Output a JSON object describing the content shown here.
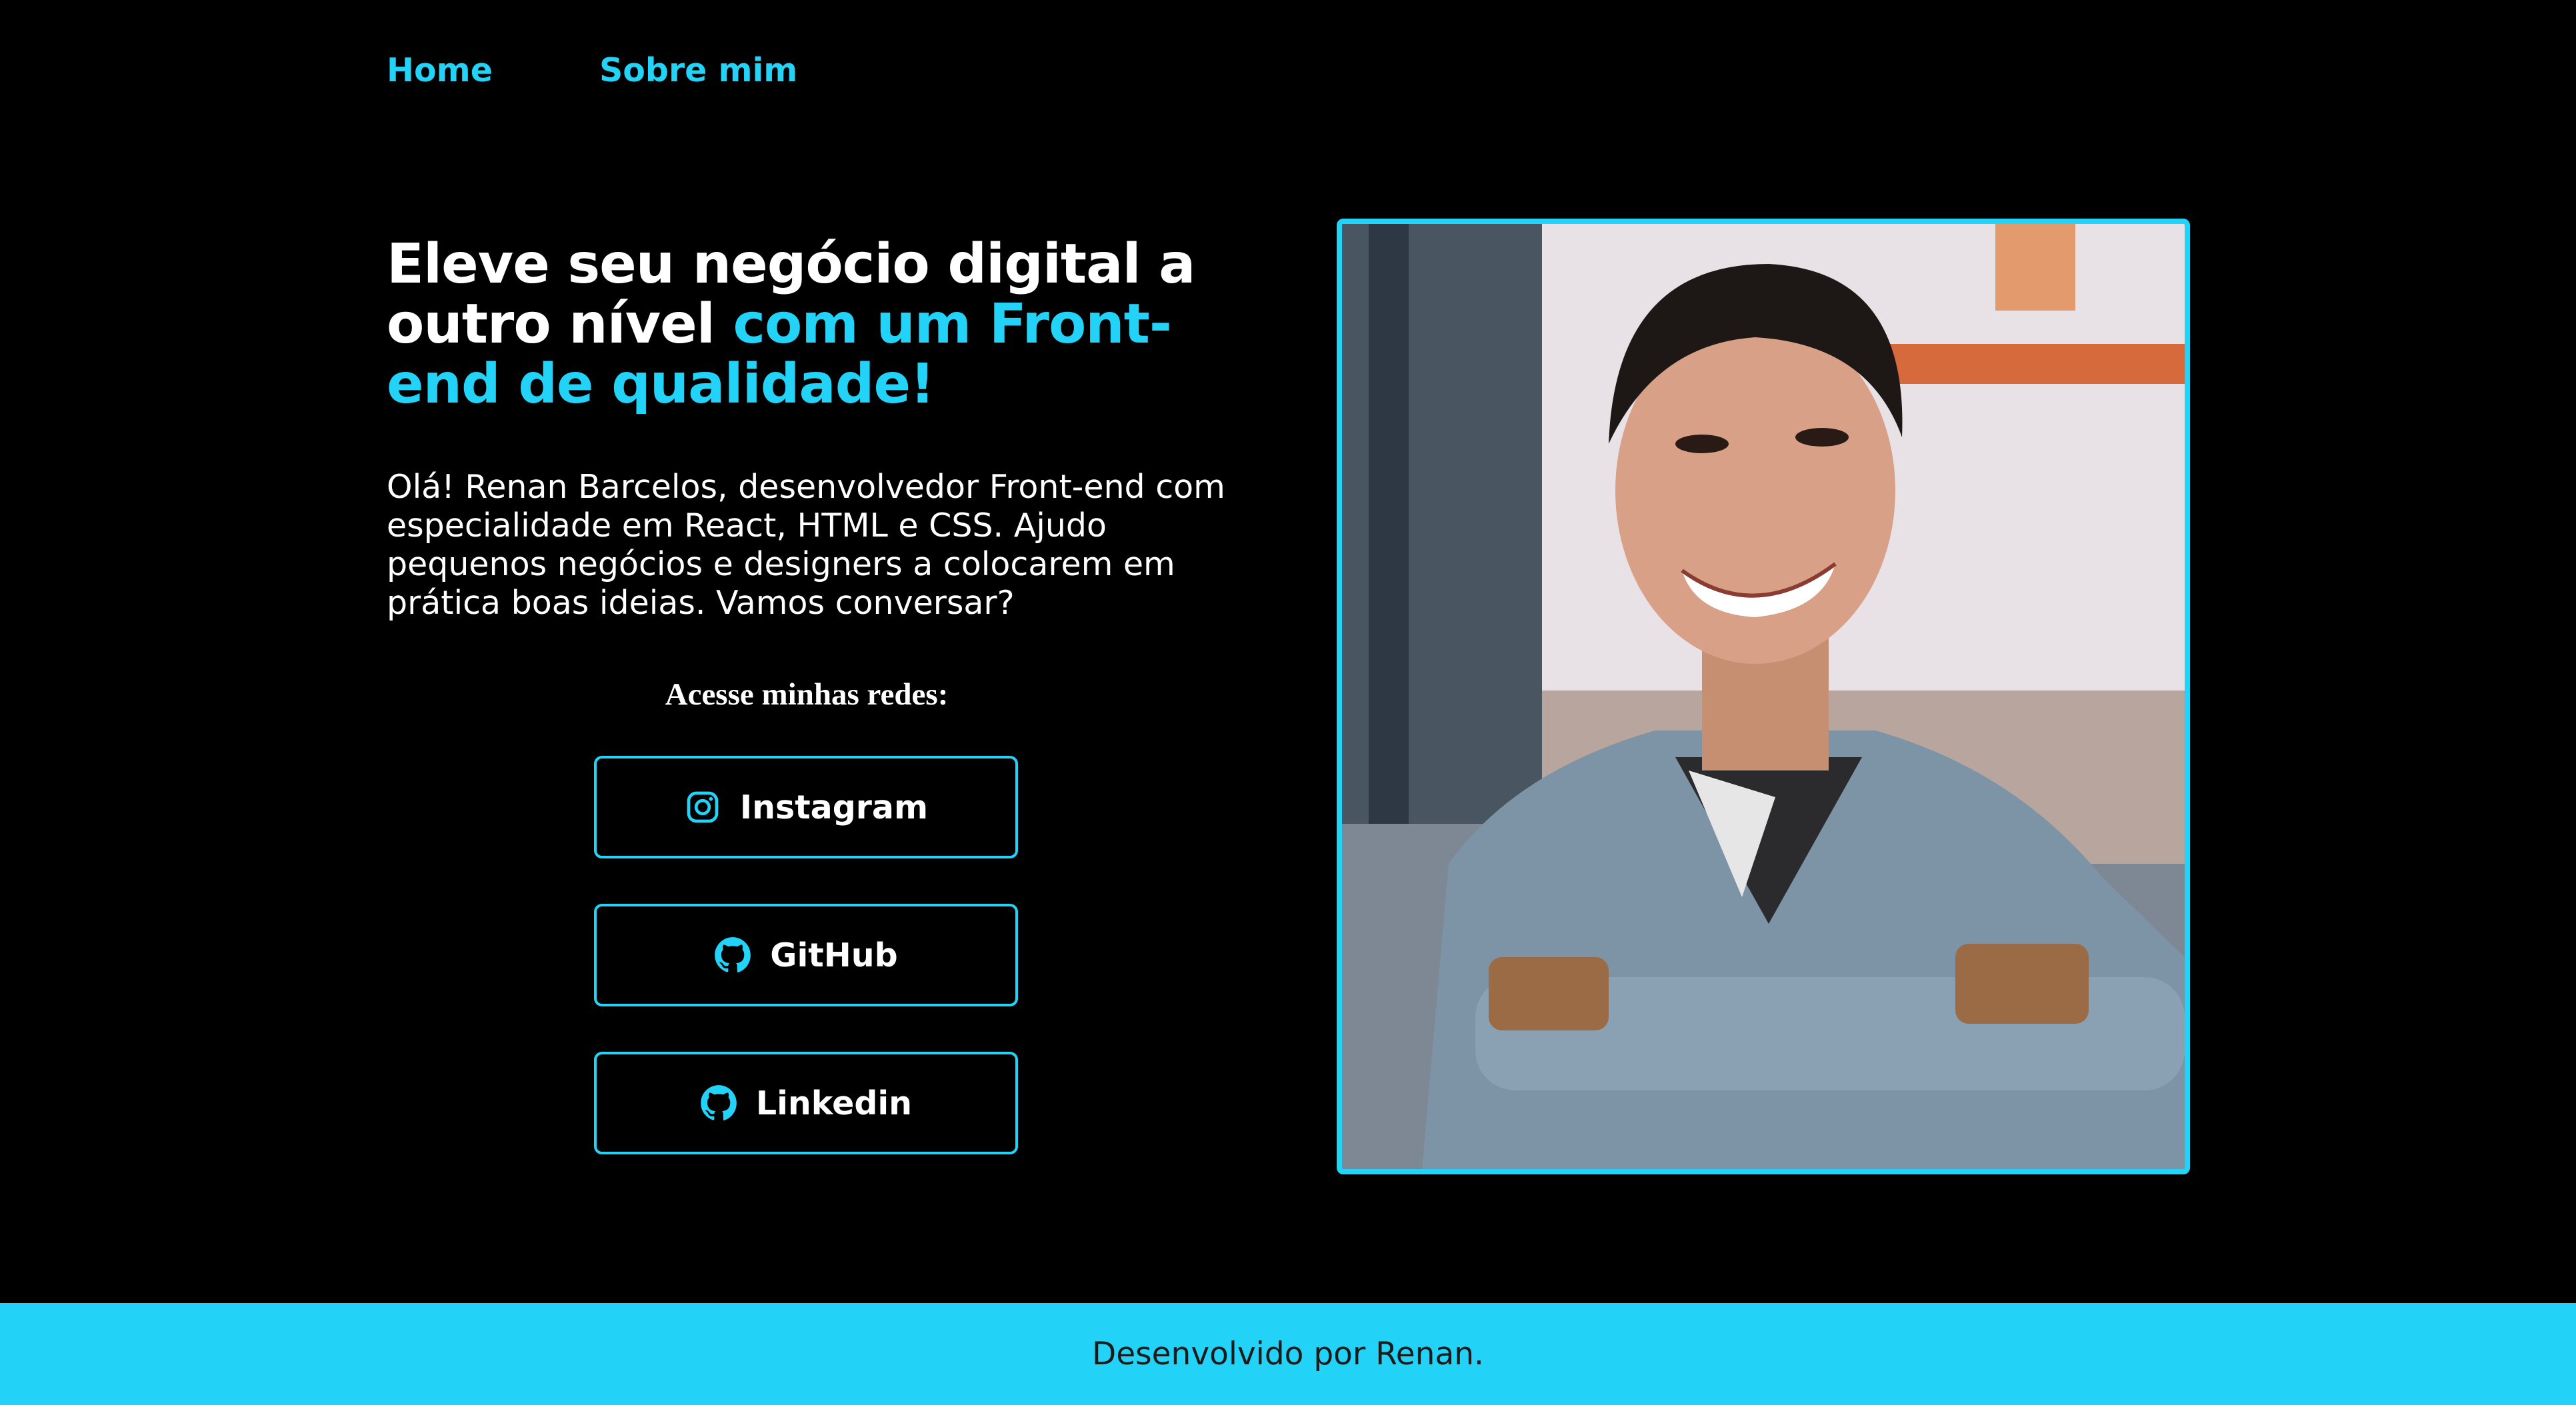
{
  "nav": {
    "items": [
      {
        "label": "Home"
      },
      {
        "label": "Sobre mim"
      }
    ]
  },
  "hero": {
    "headline_white": "Eleve seu negócio digital a outro nível ",
    "headline_accent": "com um Front-end de qualidade!",
    "intro": "Olá! Renan Barcelos, desenvolvedor Front-end com especialidade em React, HTML e CSS. Ajudo pequenos negócios e designers a colocarem em prática boas ideias. Vamos conversar?"
  },
  "social": {
    "title": "Acesse minhas redes:",
    "buttons": [
      {
        "label": "Instagram",
        "icon": "instagram-icon"
      },
      {
        "label": "GitHub",
        "icon": "github-icon"
      },
      {
        "label": "Linkedin",
        "icon": "github-icon"
      }
    ]
  },
  "photo": {
    "icon": "profile-photo"
  },
  "footer": {
    "text": "Desenvolvido por Renan."
  },
  "colors": {
    "accent": "#22d3f7",
    "background": "#000000",
    "text": "#ffffff"
  }
}
